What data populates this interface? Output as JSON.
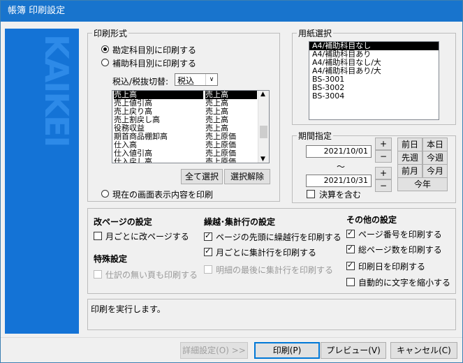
{
  "window": {
    "title": "帳簿 印刷設定"
  },
  "print_format": {
    "legend": "印刷形式",
    "option1": "勘定科目別に印刷する",
    "option2": "補助科目別に印刷する",
    "tax_label": "税込/税抜切替:",
    "tax_value": "税込",
    "list_left": [
      "売上高",
      "売上値引高",
      "売上戻り高",
      "売上割戻し高",
      "役務収益",
      "期首商品棚卸高",
      "仕入高",
      "仕入値引高",
      "仕入戻し高"
    ],
    "list_right": [
      "売上高",
      "売上高",
      "売上高",
      "売上高",
      "売上高",
      "売上原価",
      "売上原価",
      "売上原価",
      "売上原価"
    ],
    "select_all": "全て選択",
    "deselect": "選択解除",
    "option3": "現在の画面表示内容を印刷"
  },
  "paper": {
    "legend": "用紙選択",
    "items": [
      "A4/補助科目なし",
      "A4/補助科目あり",
      "A4/補助科目なし/大",
      "A4/補助科目あり/大",
      "BS-3001",
      "BS-3002",
      "BS-3004"
    ]
  },
  "period": {
    "legend": "期間指定",
    "from": "2021/10/01",
    "to": "2021/10/31",
    "tilde": "〜",
    "plus": "+",
    "minus": "−",
    "quick": [
      "前日",
      "本日",
      "先週",
      "今週",
      "前月",
      "今月"
    ],
    "this_year": "今年",
    "closing": "決算を含む"
  },
  "options": {
    "page_break_title": "改ページの設定",
    "page_break_monthly": "月ごとに改ページする",
    "special_title": "特殊設定",
    "special_blank": "仕訳の無い頁も印刷する",
    "carry_title": "繰越･集計行の設定",
    "carry_top": "ページの先頭に繰越行を印刷する",
    "carry_monthly": "月ごとに集計行を印刷する",
    "carry_end": "明細の最後に集計行を印刷する",
    "other_title": "その他の設定",
    "page_number": "ページ番号を印刷する",
    "total_pages": "総ページ数を印刷する",
    "print_date": "印刷日を印刷する",
    "auto_shrink": "自動的に文字を縮小する"
  },
  "status": "印刷を実行します。",
  "buttons": {
    "details": "詳細設定(O) >>",
    "print": "印刷(P)",
    "preview": "プレビュー(V)",
    "cancel": "キャンセル(C)"
  },
  "brand": {
    "logo": "KAIKEI"
  }
}
